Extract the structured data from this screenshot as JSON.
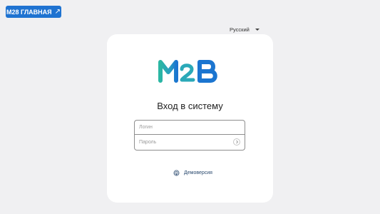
{
  "header": {
    "home_button_label": "M28 ГЛАВНАЯ",
    "home_button_icon": "external-arrow-icon"
  },
  "language": {
    "selected": "Русский"
  },
  "login_card": {
    "title": "Вход в систему",
    "login_placeholder": "Логин",
    "password_placeholder": "Пароль",
    "demo_link_label": "Демоверсия",
    "demo_icon": "fingerprint-icon",
    "submit_icon": "chevron-right-icon"
  },
  "colors": {
    "accent": "#1f73d1",
    "logo_teal": "#2bb7a3",
    "logo_blue": "#1b75d0",
    "background": "#f0f0f2"
  }
}
